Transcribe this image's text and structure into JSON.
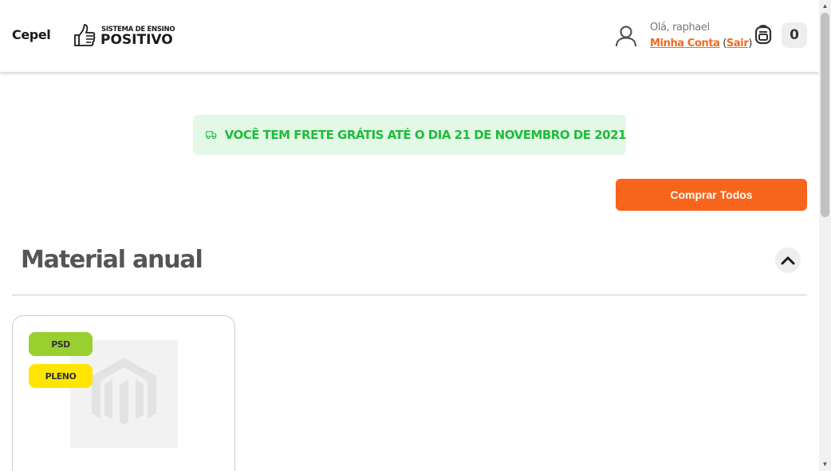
{
  "header": {
    "school_name": "Cepel",
    "brand": {
      "line1": "SISTEMA DE ENSINO",
      "line2": "POSITIVO"
    },
    "greeting": "Olá, raphael",
    "account_link": "Minha Conta",
    "logout_link": "Sair",
    "cart_count": "0",
    "user_icon": "user-icon",
    "cart_icon": "backpack-icon"
  },
  "banner": {
    "text": "VOCÊ TEM FRETE GRÁTIS ATÉ O DIA 21 DE NOVEMBRO DE 2021",
    "icon": "truck-icon"
  },
  "actions": {
    "buy_all": "Comprar Todos"
  },
  "section": {
    "title": "Material anual",
    "toggle_icon": "chevron-up-icon"
  },
  "product": {
    "badges": [
      "PSD",
      "PLENO"
    ],
    "image_icon": "magento-placeholder-icon"
  },
  "colors": {
    "accent": "#f7651c",
    "banner_bg": "#e3f8e6",
    "banner_text": "#1fbc3b",
    "badge_psd": "#99d02f",
    "badge_pleno": "#ffe500"
  }
}
